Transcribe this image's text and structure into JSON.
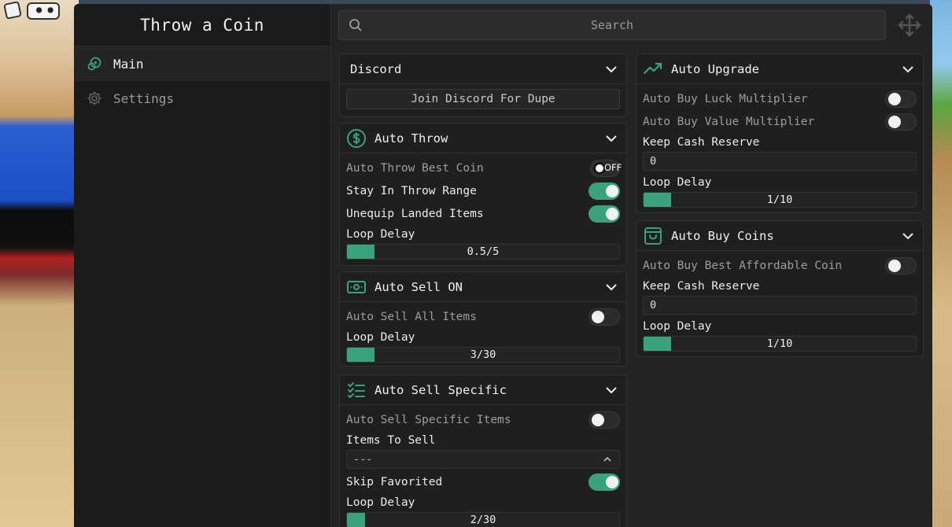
{
  "app": {
    "title": "Throw a Coin"
  },
  "sidebar": {
    "items": [
      {
        "label": "Main",
        "icon": "main-icon",
        "active": true
      },
      {
        "label": "Settings",
        "icon": "gear-icon",
        "active": false
      }
    ]
  },
  "search": {
    "placeholder": "Search"
  },
  "sections": {
    "discord": {
      "title": "Discord",
      "button_label": "Join Discord For Dupe"
    },
    "auto_throw": {
      "title": "Auto Throw",
      "icon": "dollar-circle-icon",
      "toggles": [
        {
          "label": "Auto Throw Best Coin",
          "state": "OFF",
          "on": false
        },
        {
          "label": "Stay In Throw Range",
          "on": true
        },
        {
          "label": "Unequip Landed Items",
          "on": true
        }
      ],
      "slider": {
        "label": "Loop Delay",
        "text": "0.5/5",
        "value": 0.5,
        "max": 5
      }
    },
    "auto_sell": {
      "title": "Auto Sell ON",
      "icon": "cash-icon",
      "toggles": [
        {
          "label": "Auto Sell All Items",
          "on": false
        }
      ],
      "slider": {
        "label": "Loop Delay",
        "text": "3/30",
        "value": 3,
        "max": 30
      }
    },
    "auto_sell_specific": {
      "title": "Auto Sell Specific",
      "icon": "checklist-icon",
      "toggles": [
        {
          "label": "Auto Sell Specific Items",
          "on": false
        }
      ],
      "items_label": "Items To Sell",
      "items_value": "---",
      "skip_label": "Skip Favorited",
      "skip_on": true,
      "slider": {
        "label": "Loop Delay",
        "text": "2/30",
        "value": 2,
        "max": 30
      }
    },
    "auto_upgrade": {
      "title": "Auto Upgrade",
      "icon": "trend-up-icon",
      "toggles": [
        {
          "label": "Auto Buy Luck Multiplier",
          "on": false
        },
        {
          "label": "Auto Buy Value Multiplier",
          "on": false
        }
      ],
      "reserve_label": "Keep Cash Reserve",
      "reserve_value": "0",
      "slider": {
        "label": "Loop Delay",
        "text": "1/10",
        "value": 1,
        "max": 10
      }
    },
    "auto_buy_coins": {
      "title": "Auto Buy Coins",
      "icon": "shopping-bag-icon",
      "toggles": [
        {
          "label": "Auto Buy Best Affordable Coin",
          "on": false
        }
      ],
      "reserve_label": "Keep Cash Reserve",
      "reserve_value": "0",
      "slider": {
        "label": "Loop Delay",
        "text": "1/10",
        "value": 1,
        "max": 10
      }
    }
  },
  "colors": {
    "accent": "#3aa37c",
    "window": "#232323",
    "sidebar": "#1b1b1b"
  }
}
